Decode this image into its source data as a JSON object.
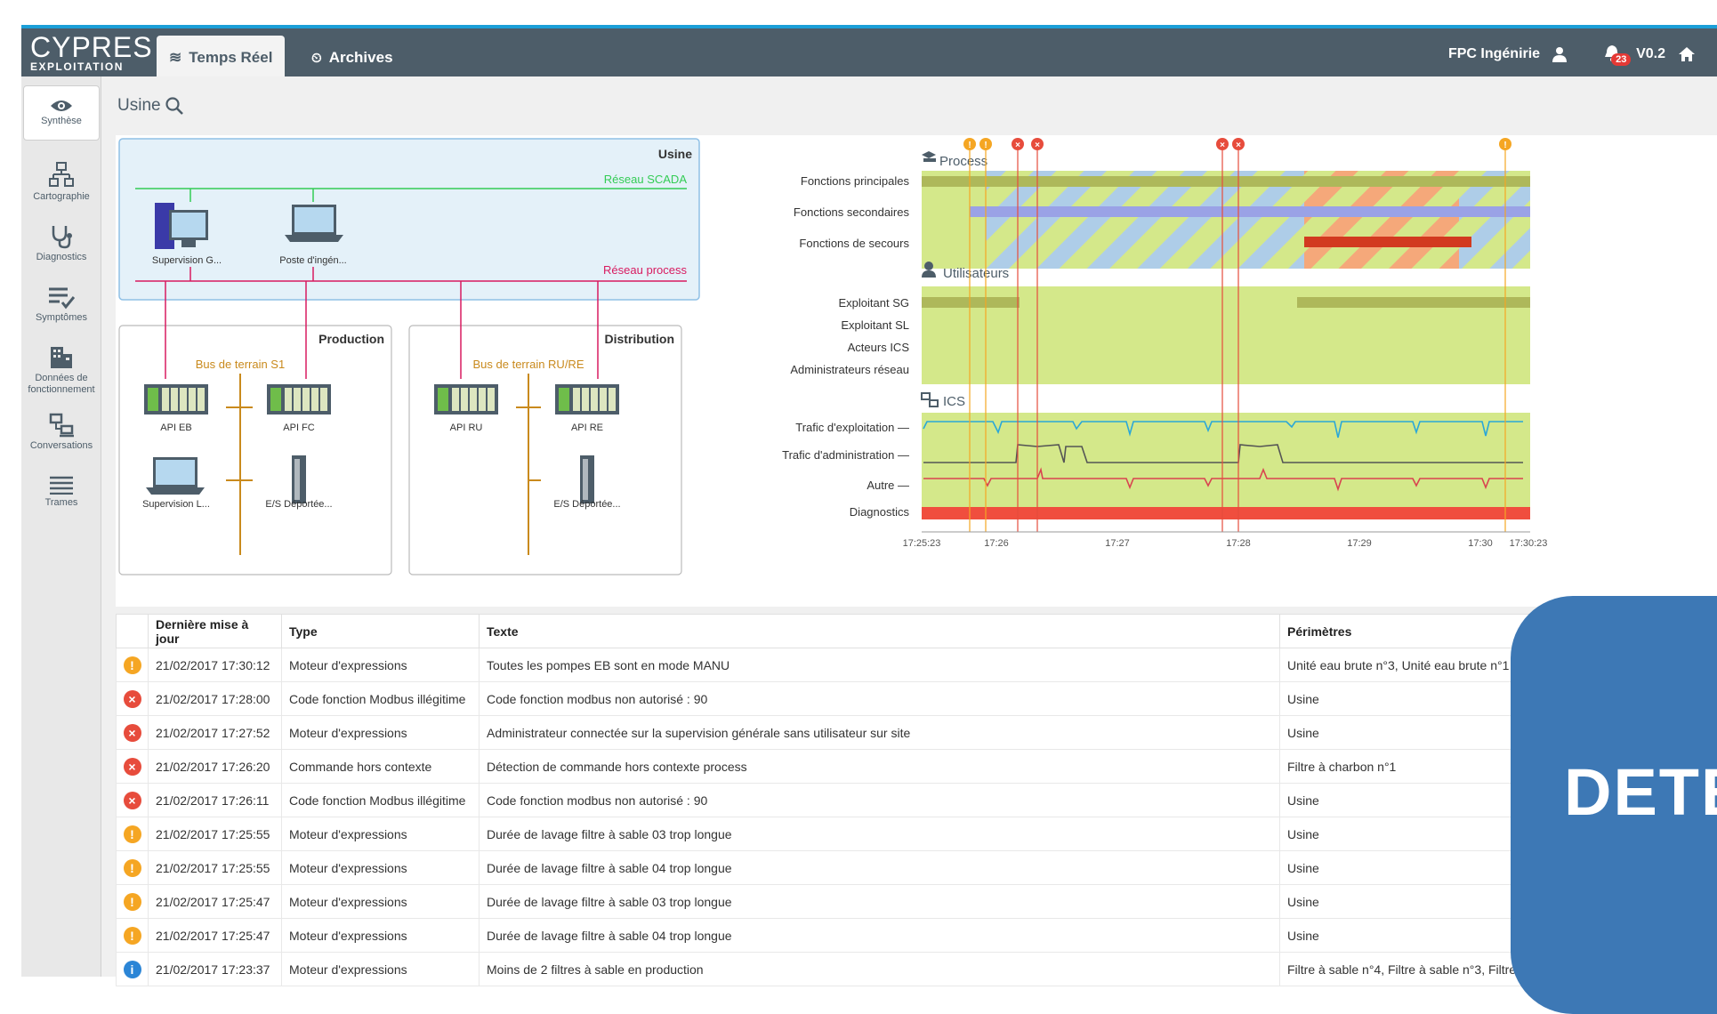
{
  "app": {
    "logo_main": "CYPRES",
    "logo_sub": "EXPLOITATION"
  },
  "tabs": [
    {
      "label": "Temps Réel",
      "active": true
    },
    {
      "label": "Archives",
      "active": false
    }
  ],
  "user": {
    "name": "FPC Ingénirie",
    "notifications": "23",
    "version": "V0.2"
  },
  "sidebar": {
    "items": [
      {
        "label": "Synthèse",
        "icon": "eye-icon",
        "active": true
      },
      {
        "label": "Cartographie",
        "icon": "network-icon"
      },
      {
        "label": "Diagnostics",
        "icon": "stethoscope-icon"
      },
      {
        "label": "Symptômes",
        "icon": "list-check-icon"
      },
      {
        "label": "Données de fonctionnement",
        "icon": "building-icon"
      },
      {
        "label": "Conversations",
        "icon": "computers-icon"
      },
      {
        "label": "Trames",
        "icon": "lines-icon"
      }
    ]
  },
  "breadcrumb": "Usine",
  "map": {
    "usine_title": "Usine",
    "scada_label": "Réseau SCADA",
    "process_label": "Réseau process",
    "supervision_g": "Supervision G...",
    "poste_ingen": "Poste d'ingén...",
    "production_title": "Production",
    "distribution_title": "Distribution",
    "bus_s1": "Bus de terrain S1",
    "bus_rure": "Bus de terrain RU/RE",
    "api_eb": "API EB",
    "api_fc": "API FC",
    "api_ru": "API RU",
    "api_re": "API RE",
    "supervision_l": "Supervision L...",
    "es_deportee_1": "E/S Déportée...",
    "es_deportee_2": "E/S Déportée..."
  },
  "timeline": {
    "sections": {
      "process": "Process",
      "users": "Utilisateurs",
      "ics": "ICS"
    },
    "process_rows": [
      "Fonctions principales",
      "Fonctions secondaires",
      "Fonctions de secours"
    ],
    "user_rows": [
      "Exploitant SG",
      "Exploitant SL",
      "Acteurs ICS",
      "Administrateurs réseau"
    ],
    "ics_rows": [
      "Trafic d'exploitation —",
      "Trafic d'administration —",
      "Autre —"
    ],
    "diagnostics_label": "Diagnostics",
    "ticks": [
      "17:25:23",
      "17:26",
      "17:27",
      "17:28",
      "17:29",
      "17:30",
      "17:30:23"
    ],
    "colors": {
      "ok": "#d4e88a",
      "blue": "#aecde8",
      "orange": "#f5a87a",
      "red": "#e74c3c",
      "warn": "#f5a623",
      "traffic_exploit": "#2aa7d8",
      "traffic_admin": "#555555",
      "traffic_other": "#d9434f"
    }
  },
  "table": {
    "headers": [
      "",
      "Dernière mise à jour",
      "Type",
      "Texte",
      "Périmètres"
    ],
    "rows": [
      {
        "sev": "warn",
        "date": "21/02/2017 17:30:12",
        "type": "Moteur d'expressions",
        "text": "Toutes les pompes EB sont en mode MANU",
        "scope": "Unité eau brute n°3, Unité eau brute n°1"
      },
      {
        "sev": "err",
        "date": "21/02/2017 17:28:00",
        "type": "Code fonction Modbus illégitime",
        "text": "Code fonction modbus non autorisé : 90",
        "scope": "Usine"
      },
      {
        "sev": "err",
        "date": "21/02/2017 17:27:52",
        "type": "Moteur d'expressions",
        "text": "Administrateur connectée sur la supervision générale sans utilisateur sur site",
        "scope": "Usine"
      },
      {
        "sev": "err",
        "date": "21/02/2017 17:26:20",
        "type": "Commande hors contexte",
        "text": "Détection de commande hors contexte process",
        "scope": "Filtre à charbon n°1"
      },
      {
        "sev": "err",
        "date": "21/02/2017 17:26:11",
        "type": "Code fonction Modbus illégitime",
        "text": "Code fonction modbus non autorisé : 90",
        "scope": "Usine"
      },
      {
        "sev": "warn",
        "date": "21/02/2017 17:25:55",
        "type": "Moteur d'expressions",
        "text": "Durée de lavage filtre à sable 03 trop longue",
        "scope": "Usine"
      },
      {
        "sev": "warn",
        "date": "21/02/2017 17:25:55",
        "type": "Moteur d'expressions",
        "text": "Durée de lavage filtre à sable 04 trop longue",
        "scope": "Usine"
      },
      {
        "sev": "warn",
        "date": "21/02/2017 17:25:47",
        "type": "Moteur d'expressions",
        "text": "Durée de lavage filtre à sable 03 trop longue",
        "scope": "Usine"
      },
      {
        "sev": "warn",
        "date": "21/02/2017 17:25:47",
        "type": "Moteur d'expressions",
        "text": "Durée de lavage filtre à sable 04 trop longue",
        "scope": "Usine"
      },
      {
        "sev": "info",
        "date": "21/02/2017 17:23:37",
        "type": "Moteur d'expressions",
        "text": "Moins de 2 filtres à sable en production",
        "scope": "Filtre à sable n°4, Filtre à sable n°3, Filtre à sa..."
      }
    ]
  },
  "overlay": {
    "text": "DETE"
  }
}
